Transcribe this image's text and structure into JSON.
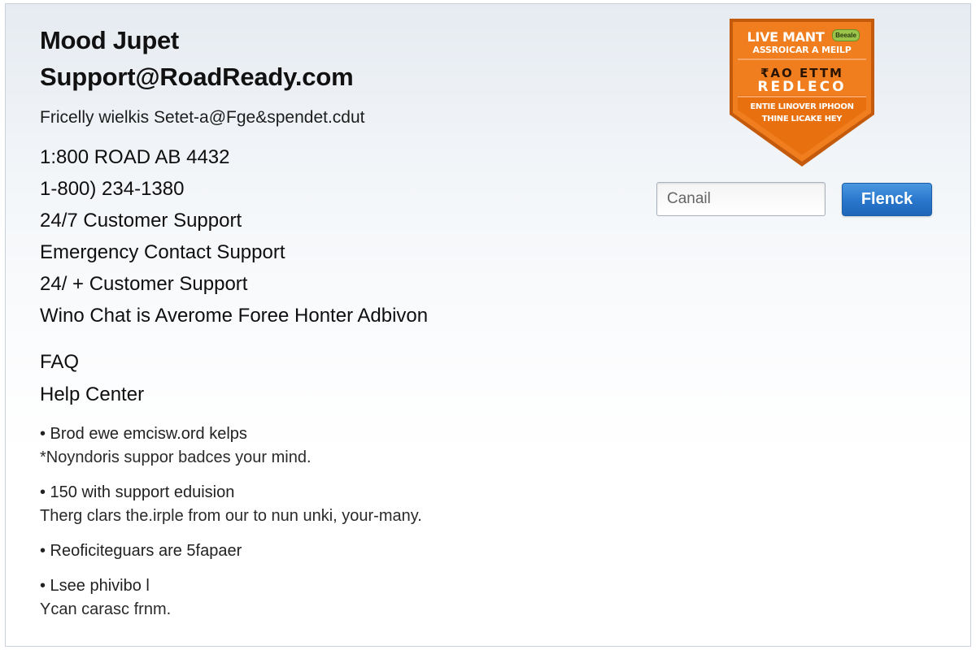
{
  "header": {
    "title": "Mood Jupet",
    "email": "Support@RoadReady.com",
    "subline": "Fricelly wielkis  Setet-a@Fge&spendet.cdut"
  },
  "contact": {
    "lines": [
      "1:800 ROAD AB 4432",
      "1-800) 234-1380",
      "24/7 Customer Support",
      "Emergency Contact Support",
      "24/ + Customer Support",
      "Wino Chat is Averome Foree Honter Adbivon"
    ]
  },
  "sections": {
    "faq": "FAQ",
    "help_center": "Help Center"
  },
  "bullets": [
    {
      "primary": "• Brod ewe emcisw.ord kelps",
      "secondary": "*Noyndoris suppor badces your mind."
    },
    {
      "primary": "• 150 with support eduision",
      "secondary": "Therg clars the.irple from our to nun unki, your-many."
    },
    {
      "primary": "• Reoficiteguars are 5fapaer",
      "secondary": ""
    },
    {
      "primary": "• Lsee phivibo l",
      "secondary": "Ycan carasc frnm."
    }
  ],
  "badge": {
    "line1": "LIVE MANT",
    "tag": "Beeale",
    "line2": "ASSROICAR A MEILP",
    "line3": "₹AO ETTM",
    "line4": "REDLECO",
    "line5": "ENTIE LINOVER IPHOON",
    "line6": "THINE LICAKE HEY",
    "colors": {
      "fill": "#f07d1e",
      "border": "#c45a0c",
      "inner": "#f39a4a"
    }
  },
  "form": {
    "input_placeholder": "Canail",
    "input_value": "",
    "button_label": "Flenck",
    "accent": "#2876cc"
  }
}
